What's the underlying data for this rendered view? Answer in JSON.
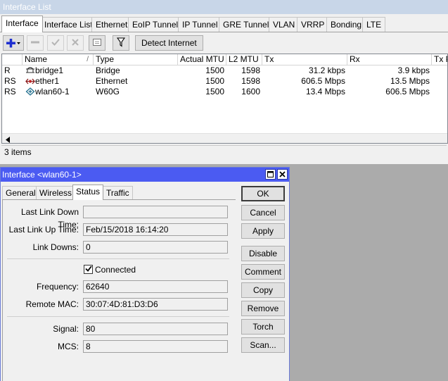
{
  "list_window": {
    "title": "Interface List",
    "tabs": [
      "Interface",
      "Interface List",
      "Ethernet",
      "EoIP Tunnel",
      "IP Tunnel",
      "GRE Tunnel",
      "VLAN",
      "VRRP",
      "Bonding",
      "LTE"
    ],
    "active_tab": "Interface",
    "toolbar": {
      "add_icon": "plus-icon",
      "detect_button": "Detect Internet"
    },
    "columns": [
      "Name",
      "Type",
      "Actual MTU",
      "L2 MTU",
      "Tx",
      "Rx",
      "Tx P"
    ],
    "sort_indicator": "/",
    "rows": [
      {
        "flags": "R",
        "icon": "bridge-icon",
        "name": "bridge1",
        "type": "Bridge",
        "actual_mtu": "1500",
        "l2_mtu": "1598",
        "tx": "31.2 kbps",
        "rx": "3.9 kbps"
      },
      {
        "flags": "RS",
        "icon": "ethernet-icon",
        "name": "ether1",
        "type": "Ethernet",
        "actual_mtu": "1500",
        "l2_mtu": "1598",
        "tx": "606.5 Mbps",
        "rx": "13.5 Mbps"
      },
      {
        "flags": "RS",
        "icon": "wireless-icon",
        "name": "wlan60-1",
        "type": "W60G",
        "actual_mtu": "1500",
        "l2_mtu": "1600",
        "tx": "13.4 Mbps",
        "rx": "606.5 Mbps"
      }
    ],
    "status": "3 items"
  },
  "dialog": {
    "title": "Interface <wlan60-1>",
    "tabs": [
      "General",
      "Wireless",
      "Status",
      "Traffic"
    ],
    "active_tab": "Status",
    "fields": {
      "last_link_down_time": {
        "label": "Last Link Down Time:",
        "value": ""
      },
      "last_link_up_time": {
        "label": "Last Link Up Time:",
        "value": "Feb/15/2018 16:14:20"
      },
      "link_downs": {
        "label": "Link Downs:",
        "value": "0"
      },
      "connected": {
        "label": "Connected",
        "checked": true
      },
      "frequency": {
        "label": "Frequency:",
        "value": "62640"
      },
      "remote_mac": {
        "label": "Remote MAC:",
        "value": "30:07:4D:81:D3:D6"
      },
      "signal": {
        "label": "Signal:",
        "value": "80"
      },
      "mcs": {
        "label": "MCS:",
        "value": "8"
      }
    },
    "buttons": [
      "OK",
      "Cancel",
      "Apply",
      "Disable",
      "Comment",
      "Copy",
      "Remove",
      "Torch",
      "Scan..."
    ]
  },
  "colors": {
    "dialog_title_bar": "#4b5bf2",
    "list_title_bar": "#c8d6e8",
    "desktop": "#ababab",
    "add_icon": "#1f2fd0"
  }
}
